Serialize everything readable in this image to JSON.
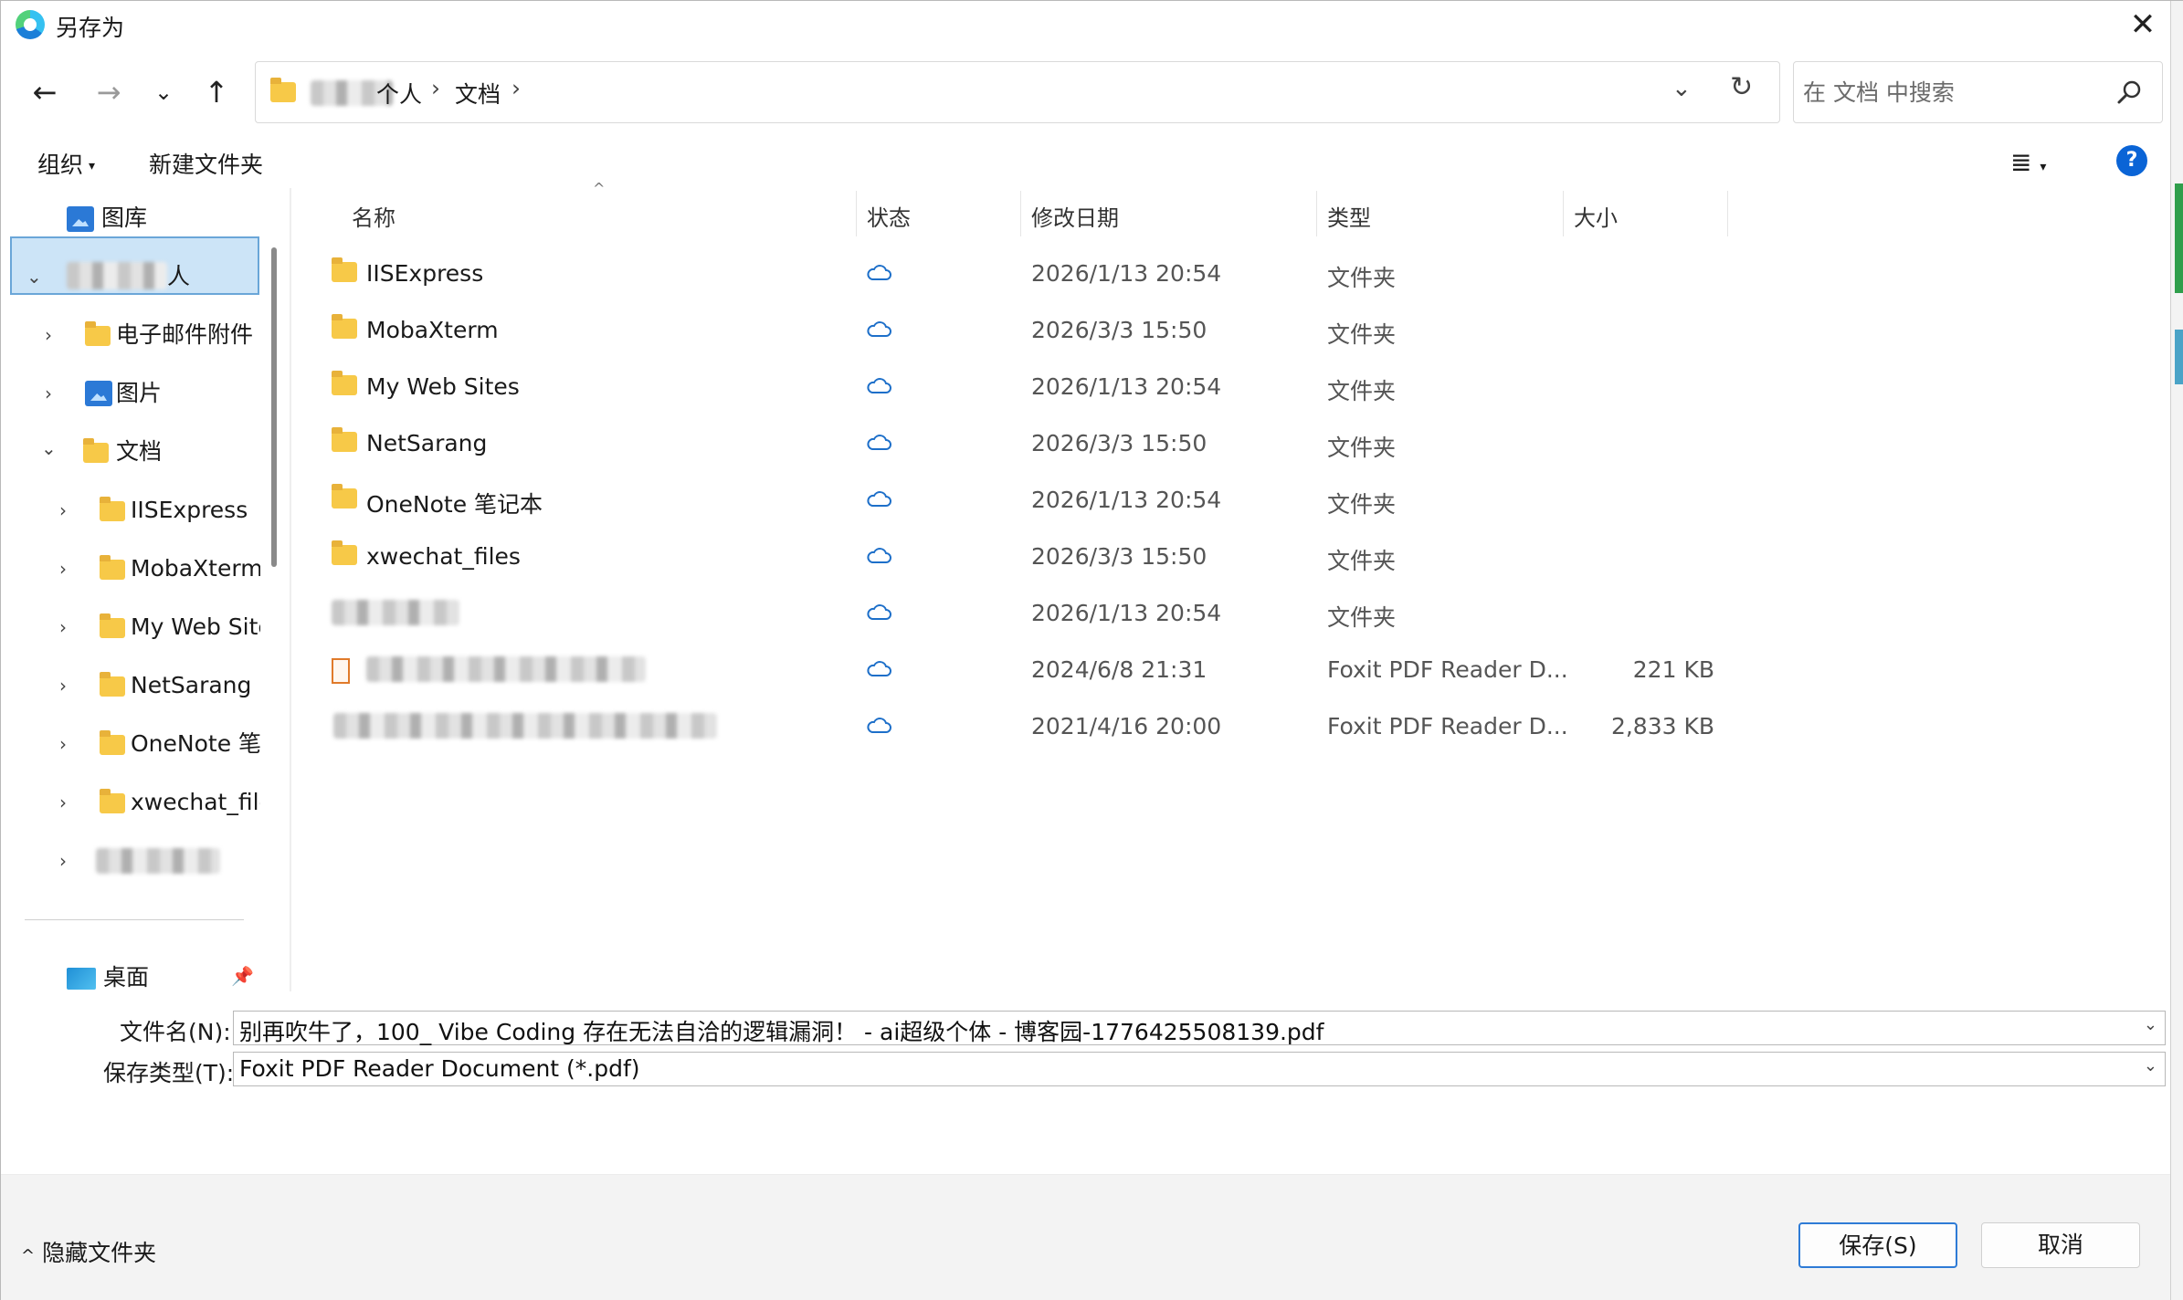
{
  "window": {
    "title": "另存为"
  },
  "address": {
    "crumbs": [
      "个人",
      "文档"
    ],
    "sep": "›"
  },
  "search": {
    "placeholder": "在 文档 中搜索"
  },
  "toolbar": {
    "organize": "组织",
    "new_folder": "新建文件夹",
    "help": "?"
  },
  "nav": {
    "gallery": "图库",
    "personal_suffix": "人",
    "items": [
      "电子邮件附件",
      "图片",
      "文档",
      "IISExpress",
      "MobaXterm",
      "My Web Sites",
      "NetSarang",
      "OneNote 笔记本",
      "xwechat_files"
    ],
    "desktop": "桌面"
  },
  "columns": {
    "name": "名称",
    "status": "状态",
    "modified": "修改日期",
    "type": "类型",
    "size": "大小"
  },
  "files": [
    {
      "name": "IISExpress",
      "date": "2026/1/13 20:54",
      "type": "文件夹",
      "size": ""
    },
    {
      "name": "MobaXterm",
      "date": "2026/3/3 15:50",
      "type": "文件夹",
      "size": ""
    },
    {
      "name": "My Web Sites",
      "date": "2026/1/13 20:54",
      "type": "文件夹",
      "size": ""
    },
    {
      "name": "NetSarang",
      "date": "2026/3/3 15:50",
      "type": "文件夹",
      "size": ""
    },
    {
      "name": "OneNote 笔记本",
      "date": "2026/1/13 20:54",
      "type": "文件夹",
      "size": ""
    },
    {
      "name": "xwechat_files",
      "date": "2026/3/3 15:50",
      "type": "文件夹",
      "size": ""
    },
    {
      "name": "",
      "date": "2026/1/13 20:54",
      "type": "文件夹",
      "size": ""
    },
    {
      "name": "",
      "date": "2024/6/8 21:31",
      "type": "Foxit PDF Reader D...",
      "size": "221 KB"
    },
    {
      "name": "",
      "date": "2021/4/16 20:00",
      "type": "Foxit PDF Reader D...",
      "size": "2,833 KB"
    }
  ],
  "form": {
    "filename_label": "文件名(N):",
    "filename_value": "别再吹牛了，100_ Vibe Coding 存在无法自洽的逻辑漏洞！ - ai超级个体 - 博客园-1776425508139.pdf",
    "filetype_label": "保存类型(T):",
    "filetype_value": "Foxit PDF Reader Document (*.pdf)"
  },
  "footer": {
    "hide_folders": "隐藏文件夹",
    "save": "保存(S)",
    "cancel": "取消"
  },
  "colors": {
    "accent": "#0a64d6",
    "selection": "#cce4f7",
    "folder": "#f7c948",
    "cloud": "#1d6fc9"
  }
}
